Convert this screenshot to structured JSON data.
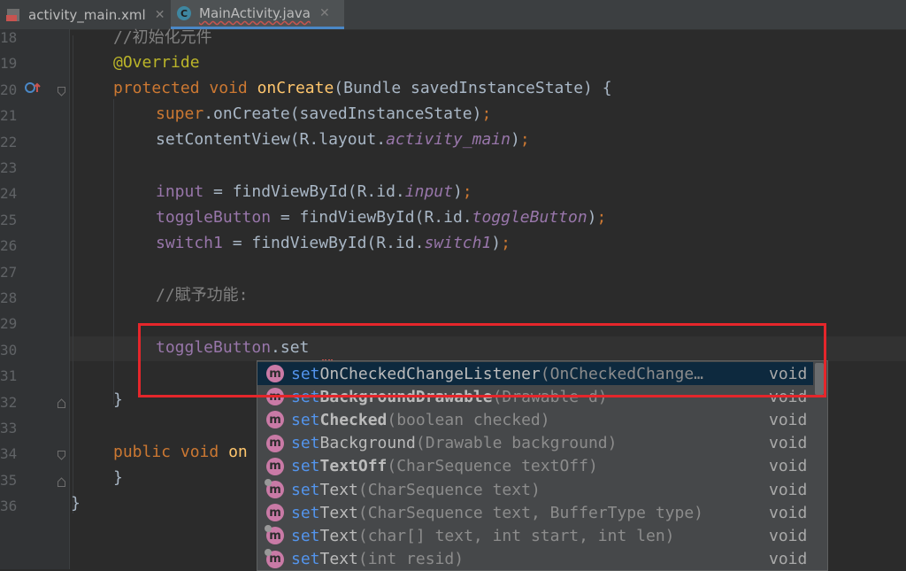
{
  "tabs": [
    {
      "label": "activity_main.xml",
      "icon": "xml-file-icon",
      "active": false
    },
    {
      "label": "MainActivity.java",
      "icon": "java-class-icon",
      "active": true
    }
  ],
  "close_glyph": "✕",
  "lines": [
    "18",
    "19",
    "20",
    "21",
    "22",
    "23",
    "24",
    "25",
    "26",
    "27",
    "28",
    "29",
    "30",
    "31",
    "32",
    "33",
    "34",
    "35",
    "36"
  ],
  "code": {
    "l18": "//初始化元件",
    "l19": "@Override",
    "l20_kw1": "protected",
    "l20_kw2": "void",
    "l20_fn": "onCreate",
    "l20_rest": "(Bundle savedInstanceState) {",
    "l21_kw": "super",
    "l21_rest": ".onCreate(savedInstanceState)",
    "l21_semi": ";",
    "l22_a": "setContentView(R.layout.",
    "l22_f": "activity_main",
    "l22_b": ")",
    "l22_semi": ";",
    "l24_v": "input",
    "l24_a": " = findViewById(R.id.",
    "l24_f": "input",
    "l24_b": ")",
    "l25_v": "toggleButton",
    "l25_a": " = findViewById(R.id.",
    "l25_f": "toggleButton",
    "l25_b": ")",
    "l26_v": "switch1",
    "l26_a": " = findViewById(R.id.",
    "l26_f": "switch1",
    "l26_b": ")",
    "semi": ";",
    "l28": "//賦予功能:",
    "l30_v": "toggleButton",
    "l30_a": ".set",
    "brace": "}",
    "l34_kw1": "public",
    "l34_kw2": "void",
    "l34_rest": "on"
  },
  "completion": [
    {
      "hl": "set",
      "rest": "OnCheckedChangeListener",
      "sig": "(OnCheckedChange…",
      "ret": "void",
      "bold": false,
      "dep": false,
      "selected": true
    },
    {
      "hl": "set",
      "rest": "BackgroundDrawable",
      "sig": "(Drawable d)",
      "ret": "void",
      "bold": true,
      "dep": false,
      "selected": false
    },
    {
      "hl": "set",
      "rest": "Checked",
      "sig": "(boolean checked)",
      "ret": "void",
      "bold": true,
      "dep": false,
      "selected": false
    },
    {
      "hl": "set",
      "rest": "Background",
      "sig": "(Drawable background)",
      "ret": "void",
      "bold": false,
      "dep": false,
      "selected": false
    },
    {
      "hl": "set",
      "rest": "TextOff",
      "sig": "(CharSequence textOff)",
      "ret": "void",
      "bold": true,
      "dep": false,
      "selected": false
    },
    {
      "hl": "set",
      "rest": "Text",
      "sig": "(CharSequence text)",
      "ret": "void",
      "bold": false,
      "dep": true,
      "selected": false
    },
    {
      "hl": "set",
      "rest": "Text",
      "sig": "(CharSequence text, BufferType type)",
      "ret": "void",
      "bold": false,
      "dep": false,
      "selected": false
    },
    {
      "hl": "set",
      "rest": "Text",
      "sig": "(char[] text, int start, int len)",
      "ret": "void",
      "bold": false,
      "dep": true,
      "selected": false
    },
    {
      "hl": "set",
      "rest": "Text",
      "sig": "(int resid)",
      "ret": "void",
      "bold": false,
      "dep": true,
      "selected": false
    }
  ],
  "method_badge": "m",
  "colors": {
    "highlight_box": "#e5262b",
    "selected_row": "#0d293e",
    "method_badge": "#c97aa6"
  }
}
